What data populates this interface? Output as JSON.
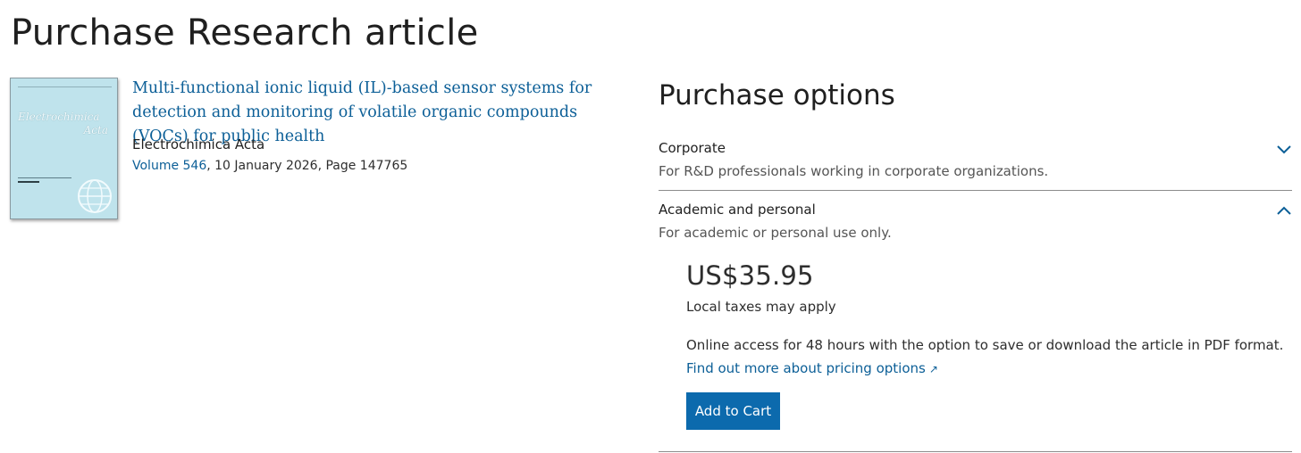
{
  "page": {
    "title": "Purchase Research article"
  },
  "article": {
    "cover": {
      "journal_title_line1": "Electrochimica",
      "journal_title_line2": "Acta"
    },
    "title": "Multi-functional ionic liquid (IL)-based sensor systems for detection and monitoring of volatile organic compounds (VOCs) for public health",
    "journal": "Electrochimica Acta",
    "volume_link": "Volume 546",
    "volume_rest": ", 10 January 2026, Page 147765"
  },
  "purchase": {
    "heading": "Purchase options",
    "options": [
      {
        "label": "Corporate",
        "description": "For R&D professionals working in corporate organizations.",
        "expanded": false,
        "icon": "chevron-down-icon"
      },
      {
        "label": "Academic and personal",
        "description": "For academic or personal use only.",
        "expanded": true,
        "icon": "chevron-up-icon"
      }
    ],
    "price": "US$35.95",
    "tax_note": "Local taxes may apply",
    "access_text": "Online access for 48 hours with the option to save or download the article in PDF format.",
    "pricing_link": "Find out more about pricing options",
    "external_icon": "↗",
    "cart_button": "Add to Cart"
  },
  "colors": {
    "link": "#0c5f97",
    "button": "#0c6aad",
    "cover": "#bfe3ec"
  }
}
